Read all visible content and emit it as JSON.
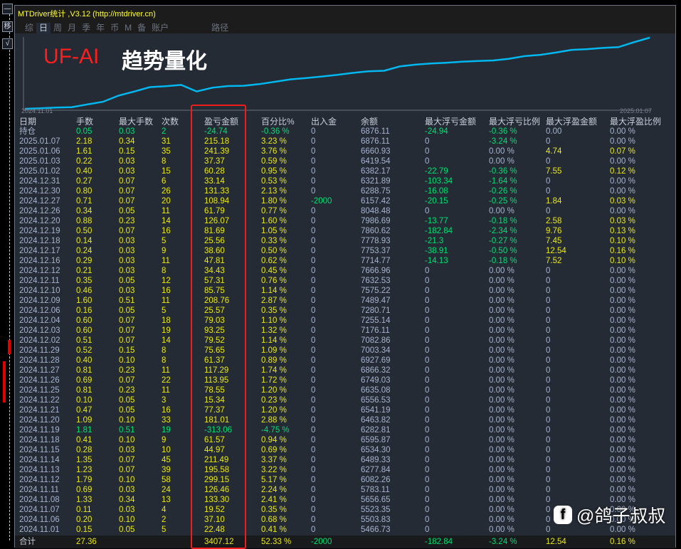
{
  "window": {
    "title": "MTDriver统计 ,V3.12 (http://mtdriver.cn)"
  },
  "side_buttons": [
    "—",
    "移",
    "√"
  ],
  "tabs": [
    {
      "label": "综"
    },
    {
      "label": "日",
      "active": true
    },
    {
      "label": "周"
    },
    {
      "label": "月"
    },
    {
      "label": "季"
    },
    {
      "label": "年"
    },
    {
      "label": "币"
    },
    {
      "label": "M"
    },
    {
      "label": "备"
    },
    {
      "label": "账户"
    },
    {
      "label": "路径"
    }
  ],
  "chart": {
    "brand": "UF-AI",
    "brand_cn": "趋势量化",
    "start_label": "2024.11.01",
    "end_label": "2025.01.07",
    "line_color": "#00b8f0"
  },
  "table": {
    "headers": [
      "日期",
      "手数",
      "最大手数",
      "次数",
      "盈亏金额",
      "百分比%",
      "出入金",
      "余额",
      "最大浮亏金额",
      "最大浮亏比例",
      "最大浮盈金额",
      "最大浮盈比例"
    ],
    "rows": [
      [
        "持仓",
        "0.05",
        "0.03",
        "2",
        "-24.74",
        "-0.36 %",
        "0",
        "6876.11",
        "-24.94",
        "-0.36 %",
        "0.00",
        "0.00 %"
      ],
      [
        "2025.01.07",
        "2.18",
        "0.34",
        "31",
        "215.18",
        "3.23 %",
        "0",
        "6876.11",
        "0",
        "-3.24 %",
        "0",
        "0.00 %"
      ],
      [
        "2025.01.06",
        "1.61",
        "0.15",
        "35",
        "241.39",
        "3.76 %",
        "0",
        "6660.93",
        "0",
        "0.00 %",
        "4.74",
        "0.07 %"
      ],
      [
        "2025.01.03",
        "0.22",
        "0.03",
        "8",
        "37.37",
        "0.59 %",
        "0",
        "6419.54",
        "0",
        "0.00 %",
        "0",
        "0.00 %"
      ],
      [
        "2025.01.02",
        "0.40",
        "0.03",
        "15",
        "60.28",
        "0.95 %",
        "0",
        "6382.17",
        "-22.79",
        "-0.36 %",
        "7.55",
        "0.12 %"
      ],
      [
        "2024.12.31",
        "0.27",
        "0.07",
        "6",
        "33.14",
        "0.53 %",
        "0",
        "6321.89",
        "-103.34",
        "-1.64 %",
        "0",
        "0.00 %"
      ],
      [
        "2024.12.30",
        "0.80",
        "0.07",
        "26",
        "131.33",
        "2.13 %",
        "0",
        "6288.75",
        "-16.08",
        "-0.26 %",
        "0",
        "0.00 %"
      ],
      [
        "2024.12.27",
        "0.71",
        "0.07",
        "20",
        "108.94",
        "1.80 %",
        "-2000",
        "6157.42",
        "-20.15",
        "-0.25 %",
        "1.84",
        "0.03 %"
      ],
      [
        "2024.12.26",
        "0.34",
        "0.05",
        "11",
        "61.79",
        "0.77 %",
        "0",
        "8048.48",
        "0",
        "0.00 %",
        "0",
        "0.00 %"
      ],
      [
        "2024.12.20",
        "0.88",
        "0.23",
        "14",
        "126.07",
        "1.60 %",
        "0",
        "7986.69",
        "-13.77",
        "-0.18 %",
        "2.58",
        "0.03 %"
      ],
      [
        "2024.12.19",
        "0.50",
        "0.07",
        "16",
        "81.69",
        "1.05 %",
        "0",
        "7860.62",
        "-182.84",
        "-2.34 %",
        "9.76",
        "0.13 %"
      ],
      [
        "2024.12.18",
        "0.14",
        "0.03",
        "5",
        "25.56",
        "0.33 %",
        "0",
        "7778.93",
        "-21.3",
        "-0.27 %",
        "7.45",
        "0.10 %"
      ],
      [
        "2024.12.17",
        "0.24",
        "0.03",
        "9",
        "38.60",
        "0.50 %",
        "0",
        "7753.37",
        "-38.91",
        "-0.50 %",
        "12.54",
        "0.16 %"
      ],
      [
        "2024.12.16",
        "0.29",
        "0.03",
        "11",
        "47.81",
        "0.62 %",
        "0",
        "7714.77",
        "-14.13",
        "-0.18 %",
        "7.52",
        "0.10 %"
      ],
      [
        "2024.12.12",
        "0.21",
        "0.03",
        "8",
        "34.43",
        "0.45 %",
        "0",
        "7666.96",
        "0",
        "0.00 %",
        "0",
        "0.00 %"
      ],
      [
        "2024.12.11",
        "0.35",
        "0.05",
        "12",
        "57.31",
        "0.76 %",
        "0",
        "7632.53",
        "0",
        "0.00 %",
        "0",
        "0.00 %"
      ],
      [
        "2024.12.10",
        "0.46",
        "0.03",
        "16",
        "85.75",
        "1.14 %",
        "0",
        "7575.22",
        "0",
        "0.00 %",
        "0",
        "0.00 %"
      ],
      [
        "2024.12.09",
        "1.60",
        "0.51",
        "11",
        "208.76",
        "2.87 %",
        "0",
        "7489.47",
        "0",
        "0.00 %",
        "0",
        "0.00 %"
      ],
      [
        "2024.12.06",
        "0.16",
        "0.05",
        "5",
        "25.57",
        "0.35 %",
        "0",
        "7280.71",
        "0",
        "0.00 %",
        "0",
        "0.00 %"
      ],
      [
        "2024.12.04",
        "0.60",
        "0.07",
        "18",
        "79.03",
        "1.10 %",
        "0",
        "7255.14",
        "0",
        "0.00 %",
        "0",
        "0.00 %"
      ],
      [
        "2024.12.03",
        "0.60",
        "0.07",
        "19",
        "93.25",
        "1.32 %",
        "0",
        "7176.11",
        "0",
        "0.00 %",
        "0",
        "0.00 %"
      ],
      [
        "2024.12.02",
        "0.51",
        "0.07",
        "14",
        "79.52",
        "1.14 %",
        "0",
        "7082.86",
        "0",
        "0.00 %",
        "0",
        "0.00 %"
      ],
      [
        "2024.11.29",
        "0.52",
        "0.15",
        "8",
        "75.65",
        "1.09 %",
        "0",
        "7003.34",
        "0",
        "0.00 %",
        "0",
        "0.00 %"
      ],
      [
        "2024.11.28",
        "0.40",
        "0.10",
        "8",
        "61.37",
        "0.89 %",
        "0",
        "6927.69",
        "0",
        "0.00 %",
        "0",
        "0.00 %"
      ],
      [
        "2024.11.27",
        "0.81",
        "0.23",
        "11",
        "117.29",
        "1.74 %",
        "0",
        "6866.32",
        "0",
        "0.00 %",
        "0",
        "0.00 %"
      ],
      [
        "2024.11.26",
        "0.69",
        "0.07",
        "22",
        "113.95",
        "1.72 %",
        "0",
        "6749.03",
        "0",
        "0.00 %",
        "0",
        "0.00 %"
      ],
      [
        "2024.11.25",
        "0.81",
        "0.23",
        "11",
        "78.55",
        "1.20 %",
        "0",
        "6635.08",
        "0",
        "0.00 %",
        "0",
        "0.00 %"
      ],
      [
        "2024.11.22",
        "0.10",
        "0.05",
        "3",
        "15.34",
        "0.23 %",
        "0",
        "6556.53",
        "0",
        "0.00 %",
        "0",
        "0.00 %"
      ],
      [
        "2024.11.21",
        "0.47",
        "0.05",
        "16",
        "77.37",
        "1.20 %",
        "0",
        "6541.19",
        "0",
        "0.00 %",
        "0",
        "0.00 %"
      ],
      [
        "2024.11.20",
        "1.09",
        "0.10",
        "33",
        "181.01",
        "2.88 %",
        "0",
        "6463.82",
        "0",
        "0.00 %",
        "0",
        "0.00 %"
      ],
      [
        "2024.11.19",
        "1.81",
        "0.51",
        "19",
        "-313.06",
        "-4.75 %",
        "0",
        "6282.81",
        "0",
        "0.00 %",
        "0",
        "0.00 %"
      ],
      [
        "2024.11.18",
        "0.41",
        "0.10",
        "9",
        "61.57",
        "0.94 %",
        "0",
        "6595.87",
        "0",
        "0.00 %",
        "0",
        "0.00 %"
      ],
      [
        "2024.11.15",
        "0.28",
        "0.03",
        "10",
        "44.97",
        "0.69 %",
        "0",
        "6534.30",
        "0",
        "0.00 %",
        "0",
        "0.00 %"
      ],
      [
        "2024.11.14",
        "1.35",
        "0.07",
        "45",
        "211.49",
        "3.37 %",
        "0",
        "6489.33",
        "0",
        "0.00 %",
        "0",
        "0.00 %"
      ],
      [
        "2024.11.13",
        "1.23",
        "0.07",
        "39",
        "195.58",
        "3.22 %",
        "0",
        "6277.84",
        "0",
        "0.00 %",
        "0",
        "0.00 %"
      ],
      [
        "2024.11.12",
        "1.79",
        "0.10",
        "58",
        "299.15",
        "5.17 %",
        "0",
        "6082.26",
        "0",
        "0.00 %",
        "0",
        "0.00 %"
      ],
      [
        "2024.11.11",
        "0.69",
        "0.03",
        "24",
        "126.46",
        "2.24 %",
        "0",
        "5783.11",
        "0",
        "0.00 %",
        "0",
        "0.00 %"
      ],
      [
        "2024.11.08",
        "1.33",
        "0.34",
        "13",
        "133.30",
        "2.41 %",
        "0",
        "5656.65",
        "0",
        "0.00 %",
        "0",
        "0.00 %"
      ],
      [
        "2024.11.07",
        "0.11",
        "0.03",
        "4",
        "19.52",
        "0.35 %",
        "0",
        "5523.35",
        "0",
        "0.00 %",
        "0",
        "0.00 %"
      ],
      [
        "2024.11.06",
        "0.20",
        "0.10",
        "2",
        "37.10",
        "0.68 %",
        "0",
        "5503.83",
        "0",
        "0.00 %",
        "0",
        "0.00 %"
      ],
      [
        "2024.11.01",
        "0.15",
        "0.05",
        "5",
        "22.48",
        "0.41 %",
        "0",
        "5466.73",
        "0",
        "0.00 %",
        "0",
        "0.00 %"
      ]
    ],
    "total": [
      "合计",
      "27.36",
      "",
      "",
      "3407.12",
      "52.33 %",
      "-2000",
      "",
      "-182.84",
      "-3.24 %",
      "12.54",
      "0.16 %"
    ]
  },
  "watermark": {
    "icon": "f",
    "text": "@鸽子叔叔"
  },
  "colors": {
    "positive": "#e8e81a",
    "negative": "#00e070",
    "neutral": "#a6b4cf",
    "highlight_box": "#ee1c1c"
  }
}
